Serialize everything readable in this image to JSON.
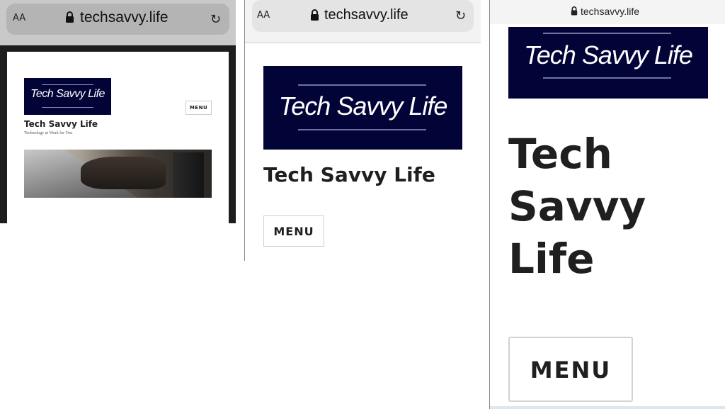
{
  "panels": [
    {
      "browser": {
        "text_size_label": "AA",
        "url": "techsavvy.life"
      },
      "logo_text": "Tech Savvy Life",
      "site_title": "Tech Savvy Life",
      "tagline": "Technology at Work for You",
      "menu_label": "MENU"
    },
    {
      "browser": {
        "text_size_label": "AA",
        "url": "techsavvy.life"
      },
      "logo_text": "Tech Savvy Life",
      "site_title": "Tech Savvy Life",
      "menu_label": "MENU"
    },
    {
      "browser": {
        "url": "techsavvy.life"
      },
      "logo_text": "Tech Savvy Life",
      "site_title": "Tech Savvy Life",
      "menu_label": "MENU"
    }
  ],
  "icons": {
    "lock": "lock-icon",
    "reload": "reload-icon"
  },
  "colors": {
    "logo_bg": "#020438",
    "text": "#1f1f1f",
    "menu_border": "#cfcfcf"
  }
}
